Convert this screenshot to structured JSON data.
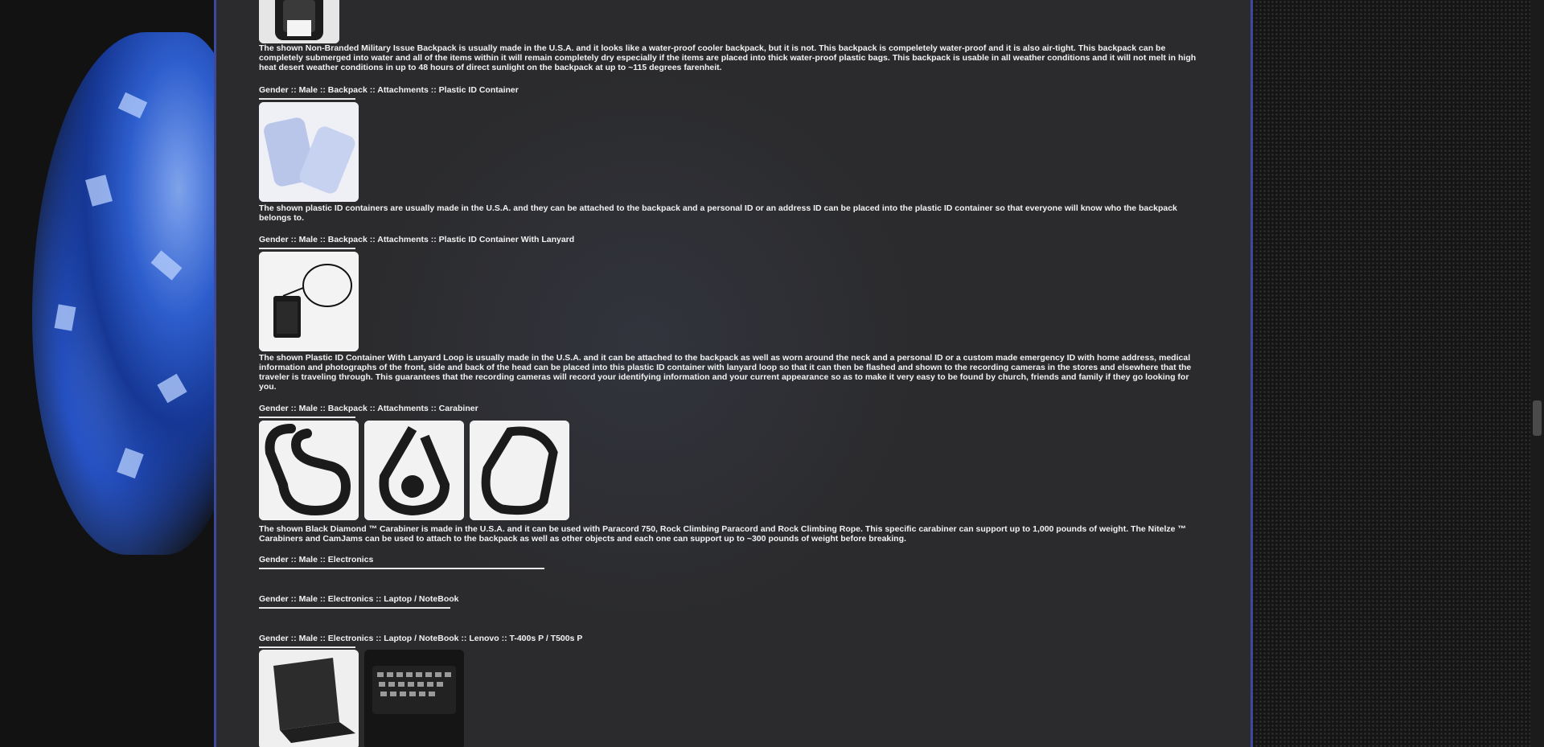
{
  "sections": {
    "backpack_desc": "The shown Non-Branded Military Issue Backpack is usually made in the U.S.A. and it looks like a water-proof cooler backpack, but it is not. This backpack is compeletely water-proof and it is also air-tight. This backpack can be completely submerged into water and all of the items within it will remain completely dry especially if the items are placed into thick water-proof plastic bags. This backpack is usable in all weather conditions and it will not melt in high heat desert weather conditions in up to 48 hours of direct sunlight on the backpack at up to ~115 degrees farenheit.",
    "plastic_id_heading": "Gender :: Male :: Backpack :: Attachments :: Plastic ID Container",
    "plastic_id_desc": "The shown plastic ID containers are usually made in the U.S.A. and they can be attached to the backpack and a personal ID or an address ID can be placed into the plastic ID container so that everyone will know who the backpack belongs to.",
    "lanyard_heading": "Gender :: Male :: Backpack :: Attachments :: Plastic ID Container With Lanyard",
    "lanyard_desc": "The shown Plastic ID Container With Lanyard Loop is usually made in the U.S.A. and it can be attached to the backpack as well as worn around the neck and a personal ID or a custom made emergency ID with home address, medical information and photographs of the front, side and back of the head can be placed into this plastic ID container with lanyard loop so that it can then be flashed and shown to the recording cameras in the stores and elsewhere that the traveler is traveling through. This guarantees that the recording cameras will record your identifying information and your current appearance so as to make it very easy to be found by church, friends and family if they go looking for you.",
    "carabiner_heading": "Gender :: Male :: Backpack :: Attachments :: Carabiner",
    "carabiner_desc": "The shown Black Diamond ™ Carabiner is made in the U.S.A. and it can be used with Paracord 750, Rock Climbing Paracord and Rock Climbing Rope. This specific carabiner can support up to 1,000 pounds of weight. The Nitelze ™ Carabiners and CamJams can be used to attach to the backpack as well as other objects and each one can support up to ~300 pounds of weight before breaking.",
    "electronics_heading": "Gender :: Male :: Electronics",
    "laptop_heading": "Gender :: Male :: Electronics :: Laptop / NoteBook",
    "lenovo_heading": "Gender :: Male :: Electronics :: Laptop / NoteBook :: Lenovo :: T-400s P / T500s P"
  },
  "colors": {
    "panel_bg": "#2b2b2d",
    "panel_border": "#3b4a9c",
    "text": "#f2f2f2",
    "accent_blue": "#3566d6"
  },
  "icons": {
    "backpack": "backpack-photo",
    "plastic_id": "plastic-id-container-photo",
    "lanyard": "id-lanyard-photo",
    "carabiner": "carabiner-photo",
    "laptop": "laptop-photo"
  }
}
